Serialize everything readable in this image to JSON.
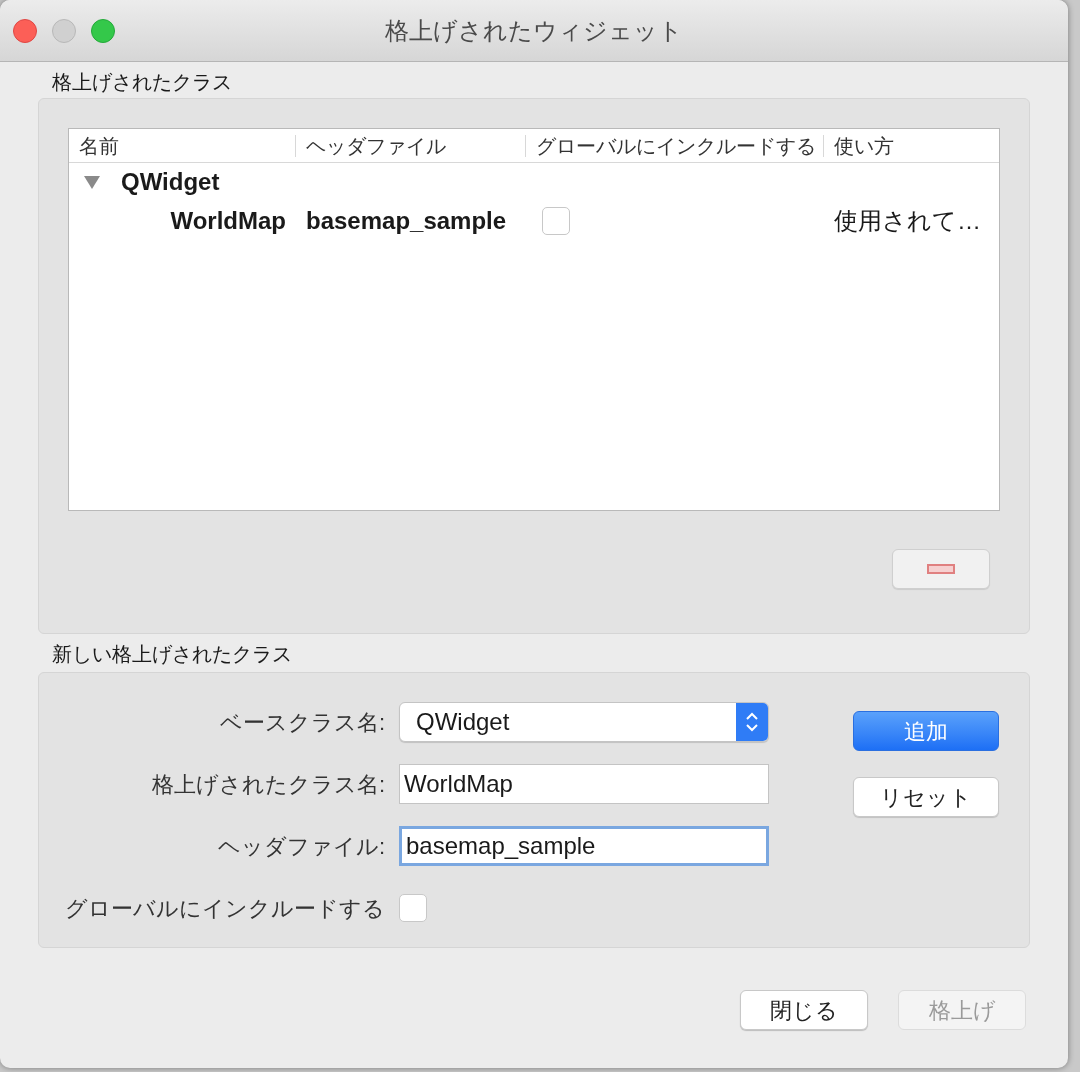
{
  "window": {
    "title": "格上げされたウィジェット"
  },
  "promoted_section": {
    "title": "格上げされたクラス",
    "table": {
      "columns": [
        "名前",
        "ヘッダファイル",
        "グローバルにインクルードする",
        "使い方"
      ],
      "rows": [
        {
          "name": "QWidget",
          "expanded": true,
          "children": [
            {
              "name": "WorldMap",
              "header_file": "basemap_sample",
              "global_include": false,
              "usage": "使用されて…"
            }
          ]
        }
      ]
    }
  },
  "new_section": {
    "title": "新しい格上げされたクラス",
    "fields": [
      {
        "kind": "select",
        "label": "ベースクラス名:",
        "value": "QWidget",
        "focused": false
      },
      {
        "kind": "text",
        "label": "格上げされたクラス名:",
        "value": "WorldMap",
        "focused": false
      },
      {
        "kind": "text",
        "label": "ヘッダファイル:",
        "value": "basemap_sample",
        "focused": true
      },
      {
        "kind": "checkbox",
        "label": "グローバルにインクルードする",
        "checked": false
      }
    ],
    "buttons": [
      {
        "label": "追加",
        "default": true
      },
      {
        "label": "リセット",
        "default": false
      }
    ]
  },
  "footer_buttons": [
    {
      "label": "閉じる",
      "disabled": false
    },
    {
      "label": "格上げ",
      "disabled": true
    }
  ]
}
